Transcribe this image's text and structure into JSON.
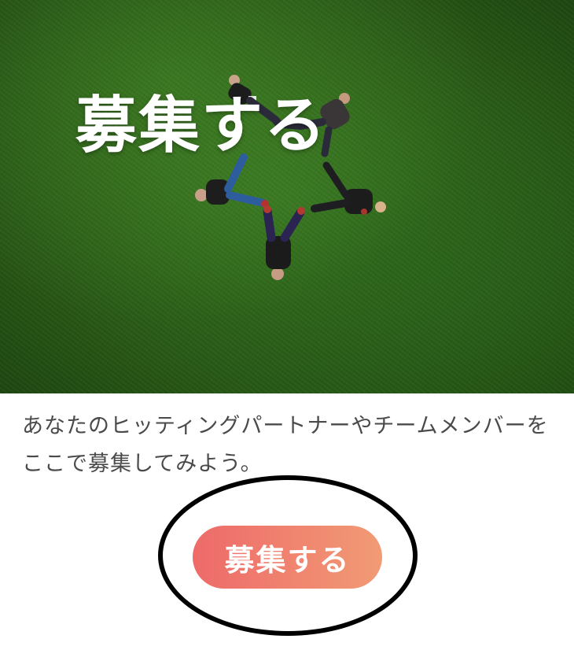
{
  "hero": {
    "title": "募集する",
    "image_name": "people-lying-in-star-shape-on-grass-photo"
  },
  "description": "あなたのヒッティングパートナーやチームメンバーをここで募集してみよう。",
  "cta": {
    "label": "募集する",
    "gradient_start": "#ee6a6a",
    "gradient_end": "#f19b74"
  },
  "annotation": {
    "type": "circled-highlight",
    "color": "#000000"
  },
  "colors": {
    "title_text": "#ffffff",
    "body_text": "#4a4a4a",
    "grass": "#2c5f17"
  }
}
